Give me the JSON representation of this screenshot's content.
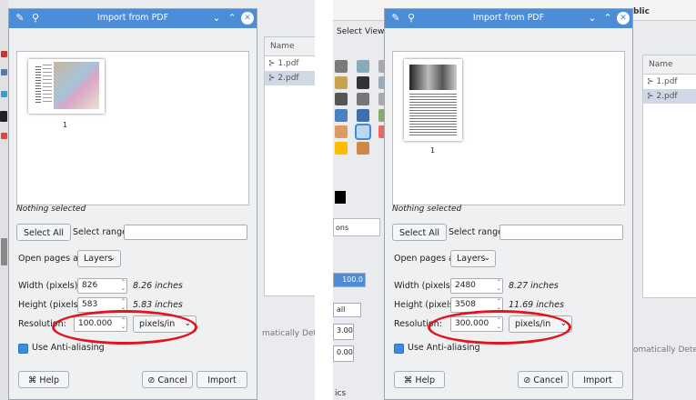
{
  "bg_left": {
    "file_list": {
      "header": "Name",
      "files": [
        "1.pdf",
        "2.pdf"
      ]
    },
    "status_text": "matically Detect"
  },
  "bg_right": {
    "menu": [
      "Select",
      "View"
    ],
    "top_text": "blic",
    "file_list": {
      "header": "Name",
      "files": [
        "1.pdf",
        "2.pdf"
      ]
    },
    "status_text": "omatically Detect",
    "tab_fragment": "ons",
    "tab_fragment2": "ics",
    "opacity_value": "100.0",
    "small_label": "all",
    "spin_values": [
      "3.00",
      "0.00"
    ]
  },
  "dialogs": [
    {
      "title": "Import from PDF",
      "page_number": "1",
      "status": "Nothing selected",
      "select_all": "Select All",
      "select_range_label": "Select range:",
      "select_range_value": "",
      "open_pages_label": "Open pages as",
      "open_pages_value": "Layers",
      "width_label": "Width (pixels):",
      "width_value": "826",
      "width_inches": "8.26 inches",
      "height_label": "Height (pixels):",
      "height_value": "583",
      "height_inches": "5.83 inches",
      "resolution_label": "Resolution:",
      "resolution_value": "100.000",
      "resolution_unit": "pixels/in",
      "antialias_label": "Use Anti-aliasing",
      "help": "Help",
      "cancel": "Cancel",
      "import": "Import"
    },
    {
      "title": "Import from PDF",
      "page_number": "1",
      "status": "Nothing selected",
      "select_all": "Select All",
      "select_range_label": "Select range:",
      "select_range_value": "",
      "open_pages_label": "Open pages as",
      "open_pages_value": "Layers",
      "width_label": "Width (pixels):",
      "width_value": "2480",
      "width_inches": "8.27 inches",
      "height_label": "Height (pixels):",
      "height_value": "3508",
      "height_inches": "11.69 inches",
      "resolution_label": "Resolution:",
      "resolution_value": "300.000",
      "resolution_unit": "pixels/in",
      "antialias_label": "Use Anti-aliasing",
      "help": "Help",
      "cancel": "Cancel",
      "import": "Import"
    }
  ],
  "colors": {
    "titlebar": "#4d8cd6",
    "highlight_ellipse": "#e0151d",
    "checkbox": "#3a8de0"
  }
}
